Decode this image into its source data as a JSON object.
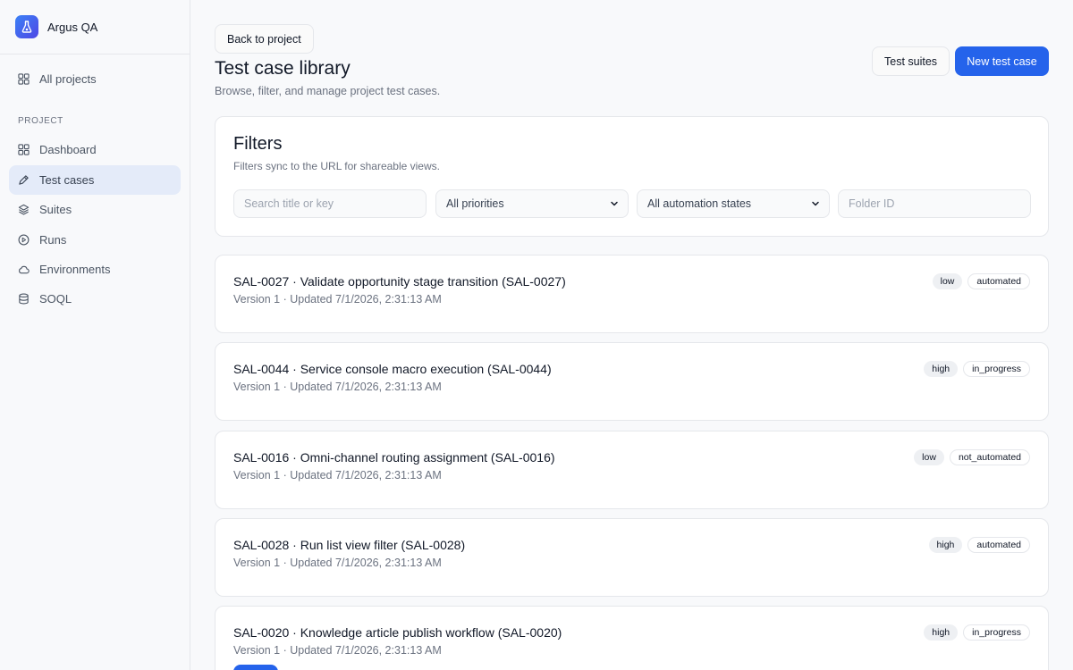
{
  "sidebar": {
    "app_name": "Argus QA",
    "all_projects": "All projects",
    "section_label": "PROJECT",
    "items": [
      {
        "label": "Dashboard",
        "icon": "grid-icon"
      },
      {
        "label": "Test cases",
        "icon": "pencil-icon"
      },
      {
        "label": "Suites",
        "icon": "layers-icon"
      },
      {
        "label": "Runs",
        "icon": "play-circle-icon"
      },
      {
        "label": "Environments",
        "icon": "cloud-icon"
      },
      {
        "label": "SOQL",
        "icon": "database-icon"
      }
    ]
  },
  "header": {
    "back_label": "Back to project",
    "title": "Test case library",
    "subtitle": "Browse, filter, and manage project test cases.",
    "suites_label": "Test suites",
    "new_label": "New test case"
  },
  "filters": {
    "title": "Filters",
    "subtitle": "Filters sync to the URL for shareable views.",
    "search_placeholder": "Search title or key",
    "priority_value": "All priorities",
    "automation_value": "All automation states",
    "folder_placeholder": "Folder ID"
  },
  "test_cases": [
    {
      "title": "SAL-0027 · Validate opportunity stage transition (SAL-0027)",
      "meta": "Version 1 · Updated 7/1/2026, 2:31:13 AM",
      "priority": "low",
      "automation": "automated"
    },
    {
      "title": "SAL-0044 · Service console macro execution (SAL-0044)",
      "meta": "Version 1 · Updated 7/1/2026, 2:31:13 AM",
      "priority": "high",
      "automation": "in_progress"
    },
    {
      "title": "SAL-0016 · Omni-channel routing assignment (SAL-0016)",
      "meta": "Version 1 · Updated 7/1/2026, 2:31:13 AM",
      "priority": "low",
      "automation": "not_automated"
    },
    {
      "title": "SAL-0028 · Run list view filter (SAL-0028)",
      "meta": "Version 1 · Updated 7/1/2026, 2:31:13 AM",
      "priority": "high",
      "automation": "automated"
    },
    {
      "title": "SAL-0020 · Knowledge article publish workflow (SAL-0020)",
      "meta": "Version 1 · Updated 7/1/2026, 2:31:13 AM",
      "priority": "high",
      "automation": "in_progress"
    }
  ],
  "colors": {
    "accent": "#2563eb",
    "active_nav_bg": "#e4ebf9"
  }
}
